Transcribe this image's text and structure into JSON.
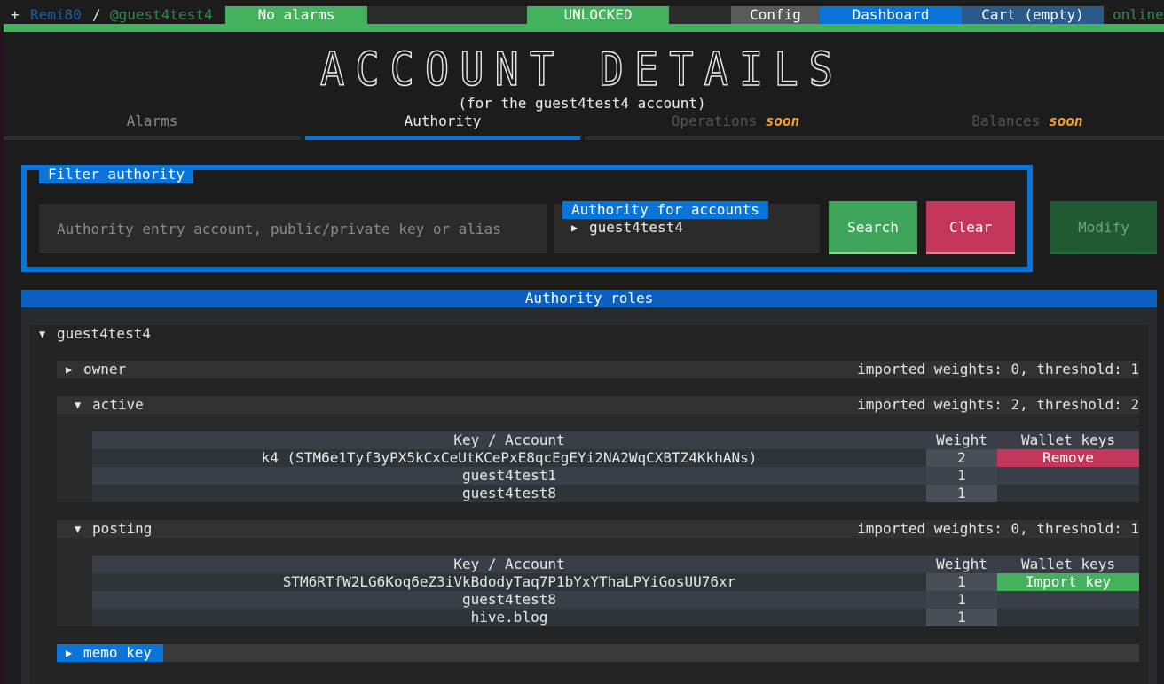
{
  "topbar": {
    "plus": "+",
    "user": "Remi80",
    "separator": "/",
    "account": "@guest4test4",
    "alarms": "No alarms",
    "lock": "UNLOCKED",
    "config": "Config",
    "dashboard": "Dashboard",
    "cart": "Cart (empty)",
    "status": "online"
  },
  "page": {
    "title": "ACCOUNT DETAILS",
    "subtitle": "(for the guest4test4 account)"
  },
  "tabs": [
    {
      "label": "Alarms",
      "badge": ""
    },
    {
      "label": "Authority",
      "badge": ""
    },
    {
      "label": "Operations",
      "badge": "soon"
    },
    {
      "label": "Balances",
      "badge": "soon"
    }
  ],
  "filter": {
    "legend": "Filter authority",
    "placeholder": "Authority entry account, public/private key or alias",
    "accounts_label": "Authority for accounts",
    "accounts_item": "guest4test4",
    "search": "Search",
    "clear": "Clear",
    "modify": "Modify"
  },
  "roles": {
    "header": "Authority roles",
    "account": "guest4test4",
    "owner": {
      "name": "owner",
      "summary": "imported weights: 0, threshold: 1"
    },
    "active": {
      "name": "active",
      "summary": "imported weights: 2, threshold: 2",
      "columns": [
        "Key / Account",
        "Weight",
        "Wallet keys"
      ],
      "rows": [
        {
          "key": "k4 (STM6e1Tyf3yPX5kCxCeUtKCePxE8qcEgEYi2NA2WqCXBTZ4KkhANs)",
          "weight": "2",
          "action": "Remove"
        },
        {
          "key": "guest4test1",
          "weight": "1",
          "action": ""
        },
        {
          "key": "guest4test8",
          "weight": "1",
          "action": ""
        }
      ]
    },
    "posting": {
      "name": "posting",
      "summary": "imported weights: 0, threshold: 1",
      "columns": [
        "Key / Account",
        "Weight",
        "Wallet keys"
      ],
      "rows": [
        {
          "key": "STM6RTfW2LG6Koq6eZ3iVkBdodyTaq7P1bYxYThaLPYiGosUU76xr",
          "weight": "1",
          "action": "Import key"
        },
        {
          "key": "guest4test8",
          "weight": "1",
          "action": ""
        },
        {
          "key": "hive.blog",
          "weight": "1",
          "action": ""
        }
      ]
    },
    "memo": {
      "name": "memo key"
    }
  },
  "colors": {
    "accent_blue": "#0a74d8",
    "green": "#44b25c",
    "red": "#c4375a",
    "dashboard_blue": "#0a74d8",
    "config_gray": "#5a5a5a"
  }
}
